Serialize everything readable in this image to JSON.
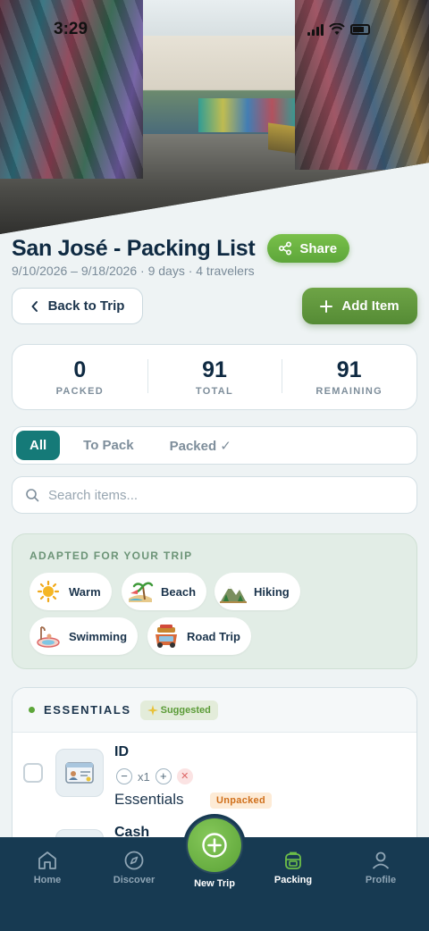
{
  "status_bar": {
    "time": "3:29"
  },
  "header": {
    "title": "San José - Packing List",
    "share_label": "Share",
    "subtitle": "9/10/2026 – 9/18/2026 · 9 days · 4 travelers"
  },
  "actions": {
    "back_label": "Back to Trip",
    "add_label": "Add Item"
  },
  "stats": [
    {
      "value": "0",
      "label": "PACKED"
    },
    {
      "value": "91",
      "label": "TOTAL"
    },
    {
      "value": "91",
      "label": "REMAINING"
    }
  ],
  "filters": {
    "tabs": [
      "All",
      "To Pack",
      "Packed ✓"
    ],
    "active": "All"
  },
  "search": {
    "placeholder": "Search items...",
    "value": ""
  },
  "adapted": {
    "title": "ADAPTED FOR YOUR TRIP",
    "chips": [
      {
        "label": "Warm",
        "icon": "sun-icon"
      },
      {
        "label": "Beach",
        "icon": "beach-icon"
      },
      {
        "label": "Hiking",
        "icon": "mountain-icon"
      },
      {
        "label": "Swimming",
        "icon": "swimming-icon"
      },
      {
        "label": "Road Trip",
        "icon": "road-trip-icon"
      }
    ]
  },
  "category": {
    "name": "ESSENTIALS",
    "badge": "Suggested",
    "items": [
      {
        "name": "ID",
        "quantity": "x1",
        "category": "Essentials",
        "status": "Unpacked",
        "icon": "id-card-icon"
      },
      {
        "name": "Cash",
        "icon": "cash-icon"
      }
    ]
  },
  "nav": {
    "items": [
      "Home",
      "Discover",
      "New Trip",
      "Packing",
      "Profile"
    ],
    "active": "Packing"
  },
  "colors": {
    "primary_green": "#5da63a",
    "teal": "#157a78",
    "navy": "#173a52",
    "unpacked_orange": "#d0701c"
  }
}
